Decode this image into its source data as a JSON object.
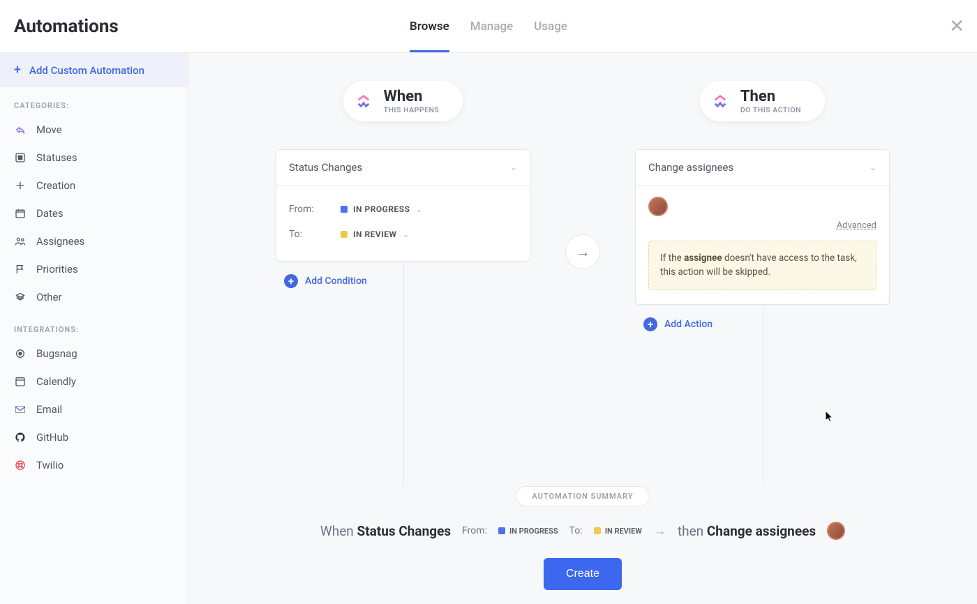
{
  "header": {
    "title": "Automations",
    "tabs": [
      {
        "label": "Browse",
        "active": true
      },
      {
        "label": "Manage",
        "active": false
      },
      {
        "label": "Usage",
        "active": false
      }
    ]
  },
  "sidebar": {
    "add_custom": "Add Custom Automation",
    "categories_hdr": "CATEGORIES:",
    "categories": [
      {
        "label": "Move",
        "icon": "share-icon"
      },
      {
        "label": "Statuses",
        "icon": "square-icon"
      },
      {
        "label": "Creation",
        "icon": "plus-cross-icon"
      },
      {
        "label": "Dates",
        "icon": "calendar-icon"
      },
      {
        "label": "Assignees",
        "icon": "people-icon"
      },
      {
        "label": "Priorities",
        "icon": "flag-icon"
      },
      {
        "label": "Other",
        "icon": "stack-icon"
      }
    ],
    "integrations_hdr": "INTEGRATIONS:",
    "integrations": [
      {
        "label": "Bugsnag",
        "icon": "bugsnag-icon"
      },
      {
        "label": "Calendly",
        "icon": "calendly-icon"
      },
      {
        "label": "Email",
        "icon": "email-icon"
      },
      {
        "label": "GitHub",
        "icon": "github-icon"
      },
      {
        "label": "Twilio",
        "icon": "twilio-icon"
      }
    ]
  },
  "when": {
    "title": "When",
    "subtitle": "THIS HAPPENS",
    "trigger": "Status Changes",
    "from_label": "From:",
    "from_status": "IN PROGRESS",
    "from_color": "#4f6ef0",
    "to_label": "To:",
    "to_status": "IN REVIEW",
    "to_color": "#f0c94f",
    "add_condition": "Add Condition"
  },
  "then": {
    "title": "Then",
    "subtitle": "DO THIS ACTION",
    "action": "Change assignees",
    "advanced": "Advanced",
    "warning_pre": "If the ",
    "warning_bold": "assignee",
    "warning_post": " doesn't have access to the task, this action will be skipped.",
    "add_action": "Add Action"
  },
  "summary": {
    "label": "AUTOMATION SUMMARY",
    "when_word": "When",
    "trigger_bold": "Status Changes",
    "from_label": "From:",
    "to_label": "To:",
    "then_word": "then",
    "action_bold": "Change assignees",
    "create": "Create"
  }
}
